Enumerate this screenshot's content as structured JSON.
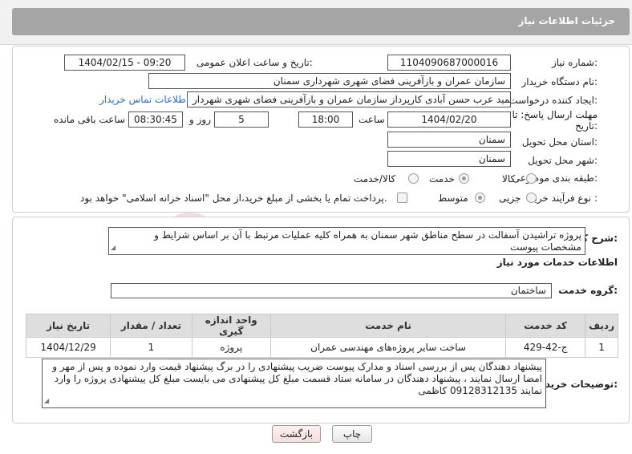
{
  "header": {
    "title": "جزئیات اطلاعات نیاز"
  },
  "form": {
    "need_number": {
      "label": "شماره نیاز:",
      "value": "1104090687000016"
    },
    "announce_datetime": {
      "label": "تاریخ و ساعت اعلان عمومی:",
      "value": "1404/02/15 - 09:20"
    },
    "buyer_org": {
      "label": "نام دستگاه خریدار:",
      "value": "سازمان عمران و بازآفرینی فضای شهری شهرداری سمنان"
    },
    "requester": {
      "label": "ایجاد کننده درخواست:",
      "value": "حمید عرب حسن آبادی کارپرداز سازمان عمران و بازآفرینی فضای شهری شهردار",
      "contact_link": "اطلاعات تماس خریدار"
    },
    "deadline": {
      "label_line1": "مهلت ارسال پاسخ: تا",
      "label_line2": "تاریخ:",
      "date": "1404/02/20",
      "time_label": "ساعت",
      "time": "18:00",
      "days": "5",
      "days_label": "روز و",
      "remaining": "08:30:45",
      "remaining_label": "ساعت باقی مانده"
    },
    "delivery_province": {
      "label": "استان محل تحویل:",
      "value": "سمنان"
    },
    "delivery_city": {
      "label": "شهر محل تحویل:",
      "value": "سمنان"
    },
    "category": {
      "label": "طبقه بندی موضوعی:",
      "options": [
        "کالا",
        "خدمت",
        "کالا/خدمت"
      ],
      "selected": "خدمت"
    },
    "purchase_type": {
      "label": "نوع فرآیند خرید :",
      "options": [
        "جزیی",
        "متوسط"
      ],
      "selected": "متوسط",
      "payment_note": "پرداخت تمام یا بخشی از مبلغ خرید،از محل \"اسناد خزانه اسلامی\" خواهد بود."
    }
  },
  "description": {
    "label": "شرح کلی نیاز:",
    "value": "پروژه تراشیدن آسفالت در سطح مناطق شهر سمنان به همراه کلیه عملیات مرتبط با آن بر اساس شرایط و مشخصات پیوست"
  },
  "services": {
    "title": "اطلاعات خدمات مورد نیاز",
    "group_label": "گروه خدمت:",
    "group_value": "ساختمان",
    "columns": [
      "ردیف",
      "کد خدمت",
      "نام خدمت",
      "واحد اندازه گیری",
      "تعداد / مقدار",
      "تاریخ نیاز"
    ],
    "rows": [
      [
        "1",
        "ج-42-429",
        "ساخت سایر پروژه‌های مهندسی عمران",
        "پروژه",
        "1",
        "1404/12/29"
      ]
    ]
  },
  "buyer_notes": {
    "label": "توضیحات خریدار:",
    "value": "پیشنهاد دهندگان پس از بررسی اسناد و مدارک پیوست ضریب پیشنهادی را در برگ پیشنهاد قیمت وارد نموده و پس از مهر و امضا ارسال نمایند ، پیشنهاد دهندگان در سامانه ستاد قسمت مبلغ کل پیشنهادی می بایست مبلغ کل پیشنهادی پروژه را وارد نمایند 09128312135 کاظمی"
  },
  "buttons": {
    "print": "چاپ",
    "back": "بازگشت"
  },
  "watermark": {
    "text": "AriaTender.net",
    "color": "#c0392b"
  }
}
